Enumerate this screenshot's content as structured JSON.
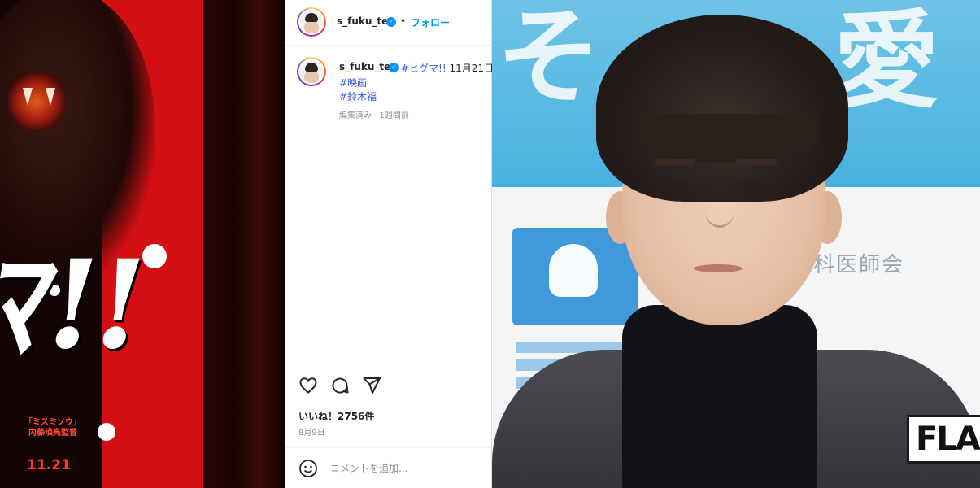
{
  "poster": {
    "title_glyphs": "ﾏ!!",
    "credit_line1": "「ミスミソウ」",
    "credit_line2": "内藤瑛亮監督",
    "date": "11.21"
  },
  "instagram": {
    "header_username": "s_fuku_te",
    "separator": "•",
    "follow_label": "フォロー",
    "caption_username": "s_fuku_te",
    "caption_hashtag1": "#ヒグマ!!",
    "caption_text": " 11月21日",
    "hashtag_movie": "#映画",
    "hashtag_name": "#鈴木福",
    "meta": "編集済み · 1週間前",
    "likes": "いいね！2756件",
    "post_date": "8月9日",
    "comment_placeholder": "コメントを追加...",
    "icons": [
      "heart-icon",
      "comment-icon",
      "share-icon",
      "emoji-icon"
    ],
    "accent_color": "#0095f6"
  },
  "photo": {
    "watermark": "FLA",
    "bg_glyphs": [
      "そ",
      "愛"
    ],
    "association_text": "科医師会"
  }
}
